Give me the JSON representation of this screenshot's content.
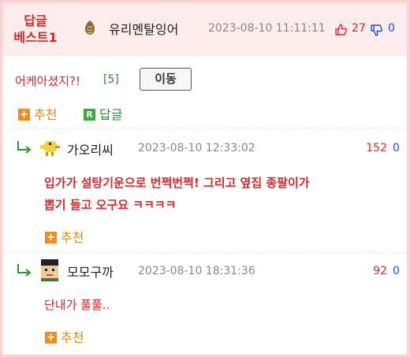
{
  "post": {
    "best_badge_line1": "답글",
    "best_badge_line2": "베스트1",
    "author": "유리멘탈잉어",
    "datetime": "2023-08-10 11:11:11",
    "upvotes": "27",
    "downvotes": "0",
    "title": "어케아셨지?!",
    "comment_count": "[5]",
    "move_label": "이동",
    "recommend_label": "추천",
    "reply_label": "답글",
    "reply_icon_letter": "R"
  },
  "comments": [
    {
      "author": "가오리씨",
      "datetime": "2023-08-10 12:33:02",
      "upvotes": "152",
      "downvotes": "0",
      "body_line1": "입가가 설탕기운으로 번쩍번쩍! 그리고 옆집 종팔이가",
      "body_line2": "뽑기 들고 오구요 ㅋㅋㅋㅋ",
      "recommend_label": "추천",
      "avatar_icon": "yellow-bird-pixel-avatar"
    },
    {
      "author": "모모구까",
      "datetime": "2023-08-10 18:31:36",
      "upvotes": "92",
      "downvotes": "0",
      "body": "단내가 풀풀..",
      "recommend_label": "추천",
      "avatar_icon": "pixel-face-avatar"
    }
  ],
  "colors": {
    "accent_red": "#d42a2a",
    "accent_blue": "#1d4ed8",
    "recommend_orange": "#f08c1a",
    "reply_green": "#3da83d",
    "frame_pink": "#fbd2d4",
    "header_bg": "#fdecec"
  },
  "icons": {
    "plus": "+",
    "thumbs_up": "thumbs-up-icon",
    "thumbs_down": "thumbs-down-icon",
    "pine_cone": "pine-cone-icon",
    "reply_arrow": "reply-arrow-icon"
  }
}
